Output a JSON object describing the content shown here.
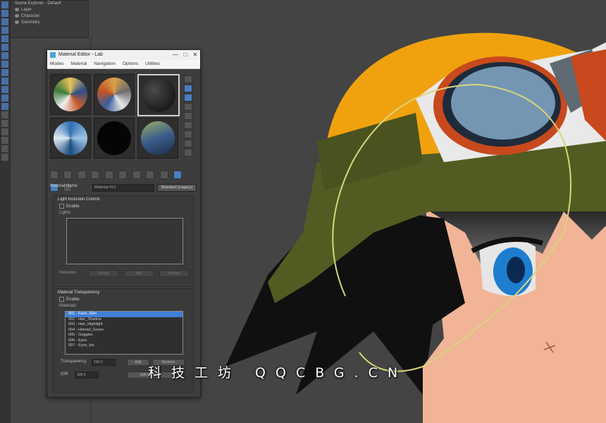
{
  "scene_explorer": {
    "rows": [
      "Scene Explorer - Default",
      "Layer",
      "Character",
      "Geometry"
    ]
  },
  "material_editor": {
    "title": "Material Editor - Lab",
    "menu": [
      "Modes",
      "Material",
      "Navigation",
      "Options",
      "Utilities"
    ],
    "window_controls": {
      "minimize": "—",
      "maximize": "□",
      "close": "✕"
    },
    "material_name_label": "Material Name",
    "material_name_value": "Material #12",
    "material_type": "Standard (Legacy)",
    "light_rollout": {
      "title": "Light Inclusion Control",
      "enable_label": "Enable",
      "lights_label": "Lights",
      "inclusion_label": "Inclusion",
      "buttons": [
        "Include",
        "Add",
        "Remove"
      ]
    },
    "material_rollout": {
      "title": "Material Transparency",
      "enable_label": "Enable",
      "materials_label": "Materials",
      "materials": [
        "001 - Face_Skin",
        "002 - Hair_Shadow",
        "003 - Hair_Highlight",
        "004 - Helmet_Green",
        "005 - Goggles",
        "006 - Eyes",
        "007 - Eyes_Iris"
      ],
      "selected_index": 0,
      "transparency_label": "Transparency",
      "transparency_value": "100.0",
      "transparency_buttons": [
        "Add",
        "Remove"
      ],
      "ior_label": "IOR",
      "ior_value": "100.0",
      "ior_button": "Edit Material"
    }
  },
  "watermark": "科技工坊 QQCBG.CN",
  "colors": {
    "viewport_bg": "#444444",
    "helmet": "#f0a20e",
    "strap": "#525c22",
    "hair": "#101010",
    "skin": "#f1b497",
    "iris": "#1d7ed0",
    "lens": "#7496b2",
    "goggle_rim": "#c7491d",
    "selection_curve": "#d8d57a",
    "selected_list_item": "#3f7fd8"
  }
}
